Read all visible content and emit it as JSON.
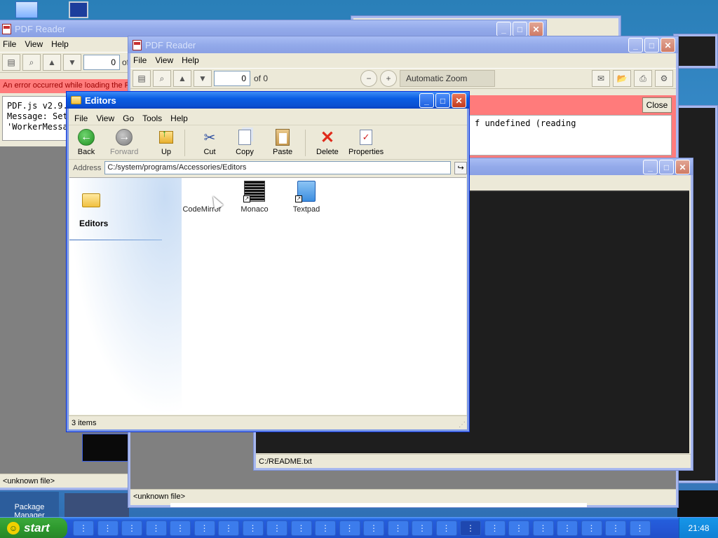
{
  "desktop": {
    "package_manager_label": "Package\nManager"
  },
  "pdf_window_back": {
    "title": "PDF Reader",
    "menu": [
      "File",
      "View",
      "Help"
    ],
    "page_value": "0",
    "page_of": "of",
    "error_banner": "An error occurred while loading the PDF",
    "console_lines": [
      "PDF.js v2.9.",
      "Message: Set",
      "'WorkerMessa"
    ],
    "status": "<unknown file>"
  },
  "pdf_window_front": {
    "title": "PDF Reader",
    "menu": [
      "File",
      "View",
      "Help"
    ],
    "page_value": "0",
    "page_of": "of 0",
    "zoom": "Automatic Zoom",
    "close_label": "Close",
    "error_text": "f undefined (reading",
    "status": "<unknown file>"
  },
  "text_window": {
    "status": "C:/README.txt"
  },
  "explorer": {
    "title": "Editors",
    "menu": [
      "File",
      "View",
      "Go",
      "Tools",
      "Help"
    ],
    "toolbar": {
      "back": "Back",
      "forward": "Forward",
      "up": "Up",
      "cut": "Cut",
      "copy": "Copy",
      "paste": "Paste",
      "delete": "Delete",
      "properties": "Properties"
    },
    "address_label": "Address",
    "address_value": "C:/system/programs/Accessories/Editors",
    "sidebar_title": "Editors",
    "files": [
      {
        "name": "CodeMirror",
        "icon": "codemirror-icon"
      },
      {
        "name": "Monaco",
        "icon": "monaco-icon"
      },
      {
        "name": "Textpad",
        "icon": "textpad-icon"
      }
    ],
    "status": "3 items"
  },
  "taskbar": {
    "start_label": "start",
    "clock": "21:48"
  },
  "colors": {
    "title_active": "#0a5de4",
    "error_red": "#ff7b7b",
    "start_green": "#2f9b2f"
  }
}
